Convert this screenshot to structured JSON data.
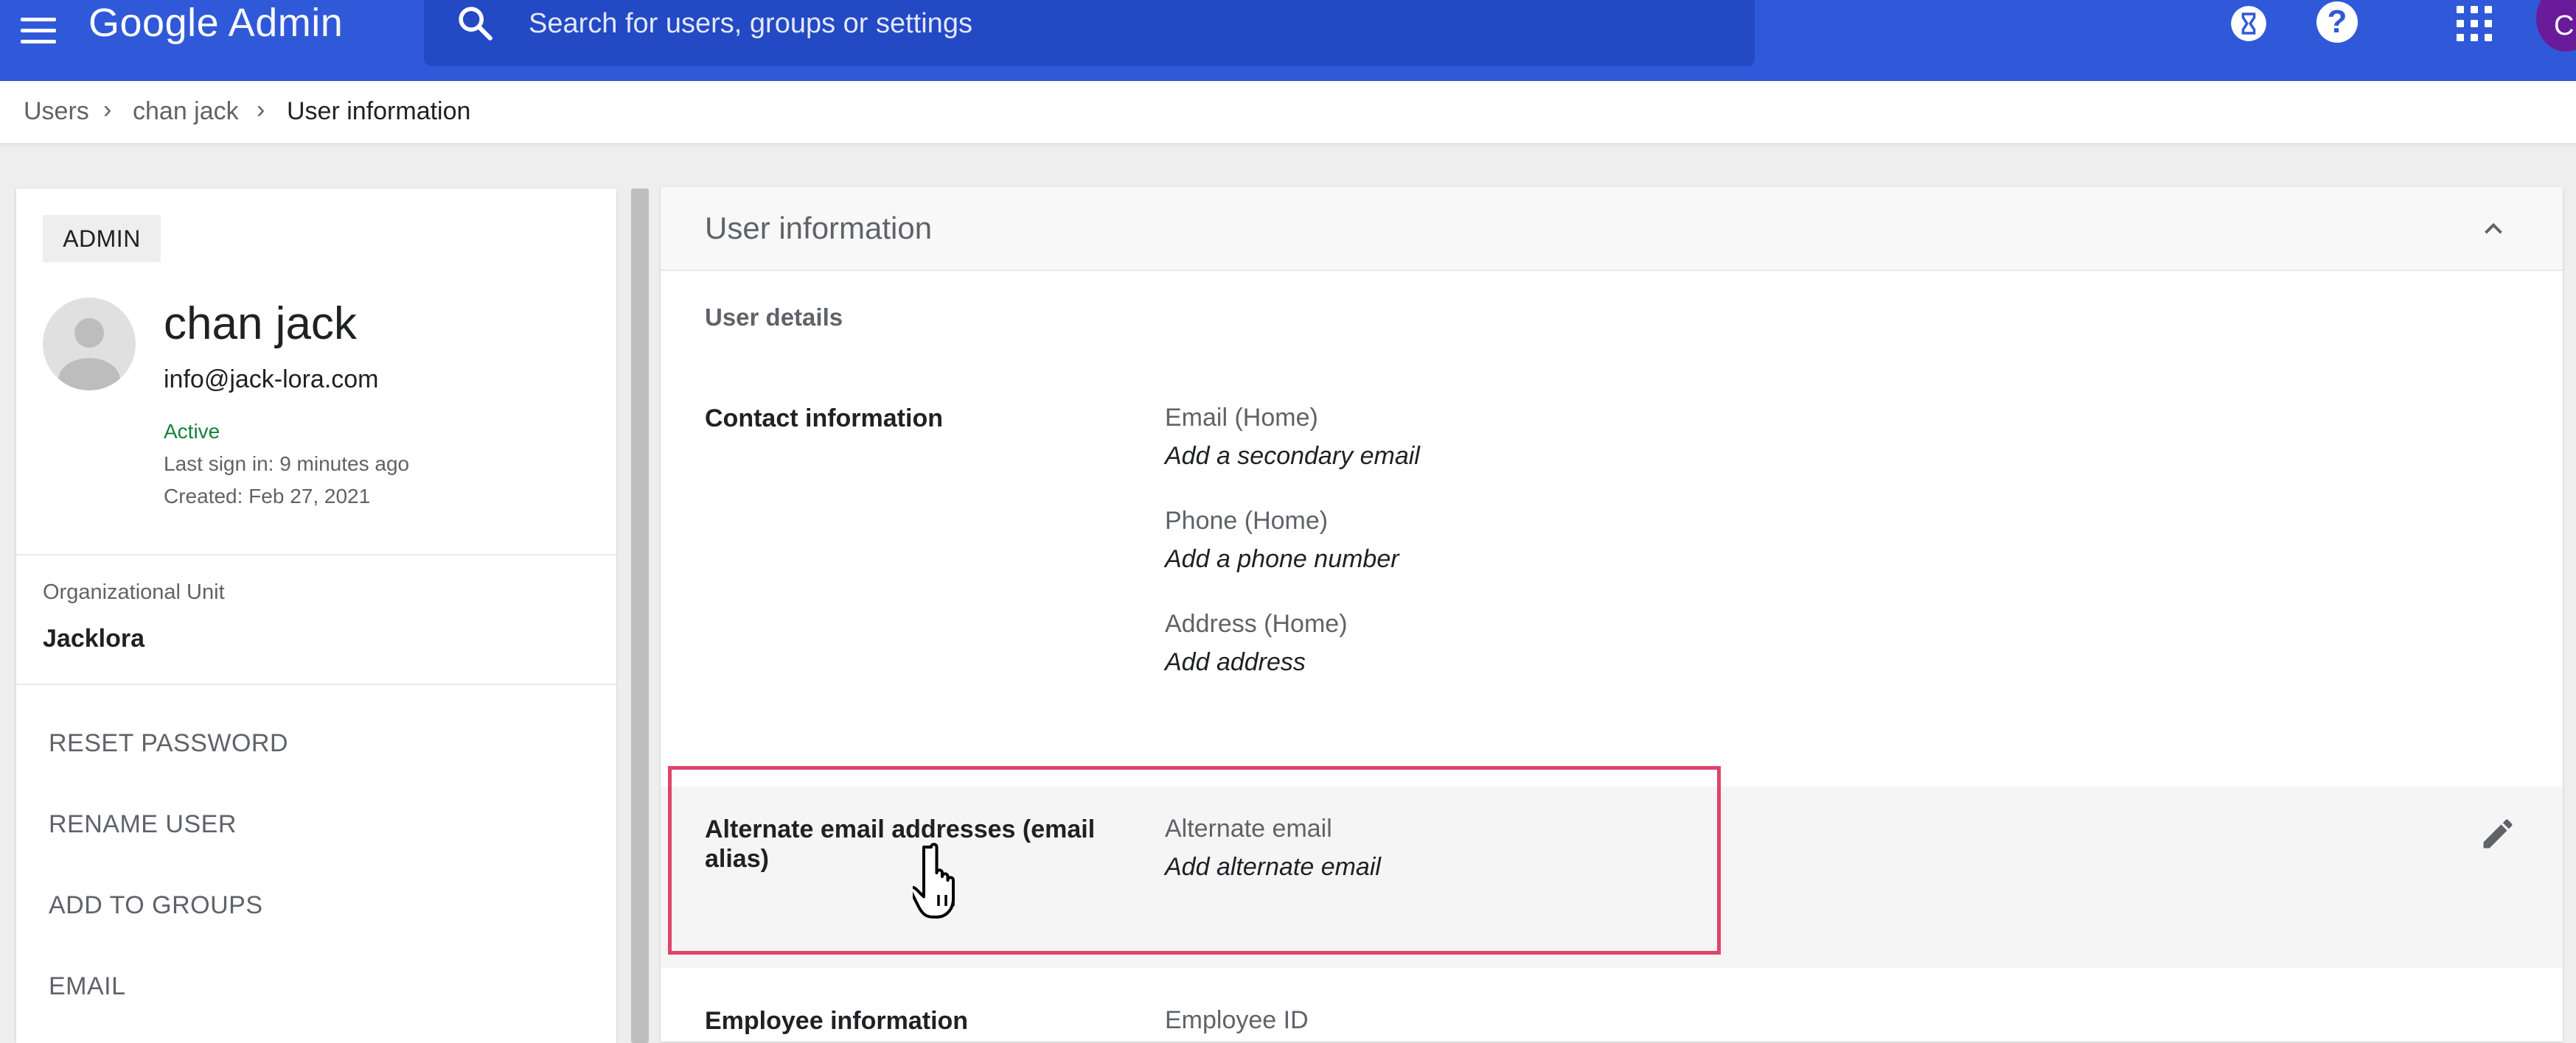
{
  "topbar": {
    "brand": "Google",
    "product": "Admin",
    "search_placeholder": "Search for users, groups or settings",
    "account_initial": "C",
    "help_glyph": "?",
    "icons": [
      "menu-icon",
      "search-icon",
      "hourglass-icon",
      "help-icon",
      "apps-icon"
    ],
    "color": "#3059d9"
  },
  "breadcrumb": [
    "Users",
    "chan jack",
    "User information"
  ],
  "left_panel": {
    "badge": "ADMIN",
    "name": "chan jack",
    "email": "info@jack-lora.com",
    "status": "Active",
    "last_sign_in": "Last sign in: 9 minutes ago",
    "created": "Created: Feb 27, 2021",
    "org_unit_label": "Organizational Unit",
    "org_unit_value": "Jacklora",
    "actions": [
      "RESET PASSWORD",
      "RENAME USER",
      "ADD TO GROUPS",
      "EMAIL"
    ]
  },
  "right_panel": {
    "title": "User information",
    "section": "User details",
    "contact": {
      "label": "Contact information",
      "fields": [
        {
          "label": "Email (Home)",
          "value": "Add a secondary email"
        },
        {
          "label": "Phone (Home)",
          "value": "Add a phone number"
        },
        {
          "label": "Address (Home)",
          "value": "Add address"
        }
      ]
    },
    "alias": {
      "label": "Alternate email addresses (email alias)",
      "field_label": "Alternate email",
      "field_value": "Add alternate email",
      "highlight_color": "#e0446a"
    },
    "employee": {
      "label": "Employee information",
      "field_label": "Employee ID"
    }
  }
}
